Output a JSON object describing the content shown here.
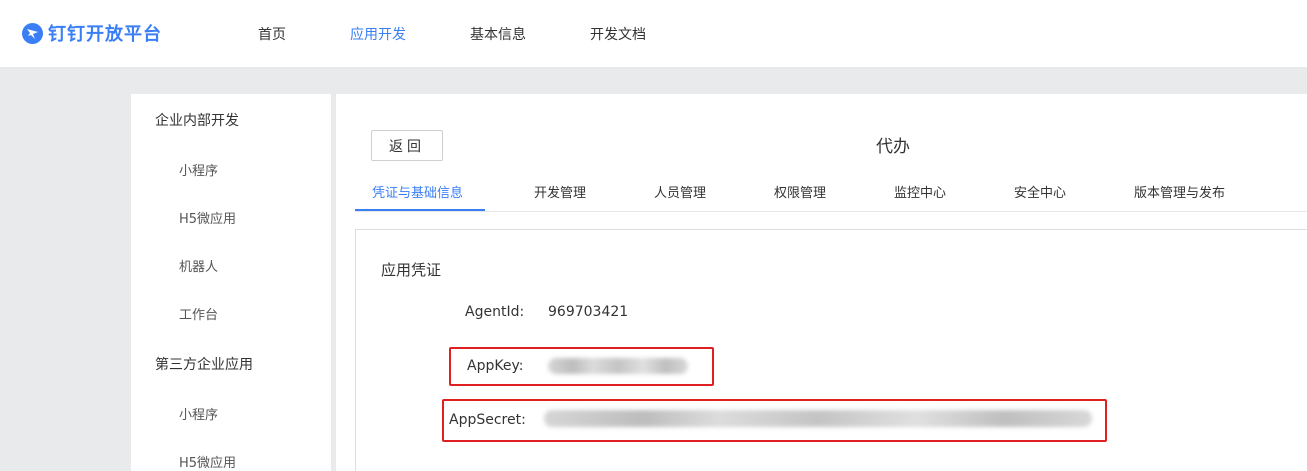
{
  "brand": {
    "name": "钉钉开放平台",
    "color": "#3a7ef5",
    "icon": "dingtalk-logo-icon"
  },
  "topnav": {
    "items": [
      {
        "label": "首页",
        "active": false
      },
      {
        "label": "应用开发",
        "active": true
      },
      {
        "label": "基本信息",
        "active": false
      },
      {
        "label": "开发文档",
        "active": false
      }
    ]
  },
  "sidebar": {
    "groups": [
      {
        "label": "企业内部开发",
        "items": [
          "小程序",
          "H5微应用",
          "机器人",
          "工作台"
        ]
      },
      {
        "label": "第三方企业应用",
        "items": [
          "小程序",
          "H5微应用"
        ]
      }
    ]
  },
  "main": {
    "back_label": "返回",
    "app_name": "代办",
    "tabs": [
      {
        "label": "凭证与基础信息",
        "active": true
      },
      {
        "label": "开发管理",
        "active": false
      },
      {
        "label": "人员管理",
        "active": false
      },
      {
        "label": "权限管理",
        "active": false
      },
      {
        "label": "监控中心",
        "active": false
      },
      {
        "label": "安全中心",
        "active": false
      },
      {
        "label": "版本管理与发布",
        "active": false
      }
    ],
    "credentials": {
      "title": "应用凭证",
      "agent_id_label": "AgentId:",
      "agent_id_value": "969703421",
      "app_key_label": "AppKey:",
      "app_secret_label": "AppSecret:"
    }
  },
  "colors": {
    "accent": "#3a7ef5",
    "highlight_box": "#e02020",
    "page_bg": "#e9eaec"
  }
}
